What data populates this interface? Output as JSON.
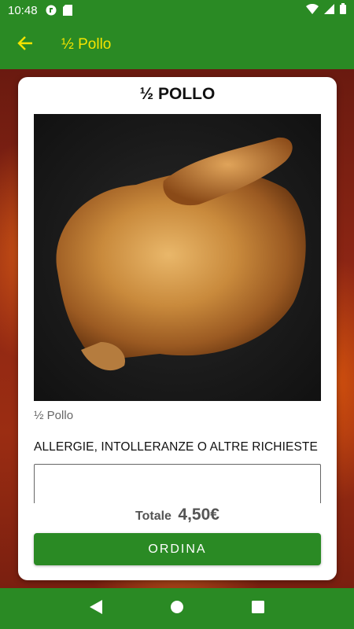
{
  "status_bar": {
    "time": "10:48"
  },
  "app_bar": {
    "title": "½ Pollo"
  },
  "product": {
    "title": "½ POLLO",
    "name": "½ Pollo",
    "notes_label": "ALLERGIE, INTOLLERANZE O ALTRE RICHIESTE",
    "notes_value": "",
    "total_label": "Totale",
    "total_value": "4,50€"
  },
  "actions": {
    "order_label": "ORDINA"
  },
  "colors": {
    "primary": "#2a8a24",
    "title_accent": "#f5e400"
  }
}
